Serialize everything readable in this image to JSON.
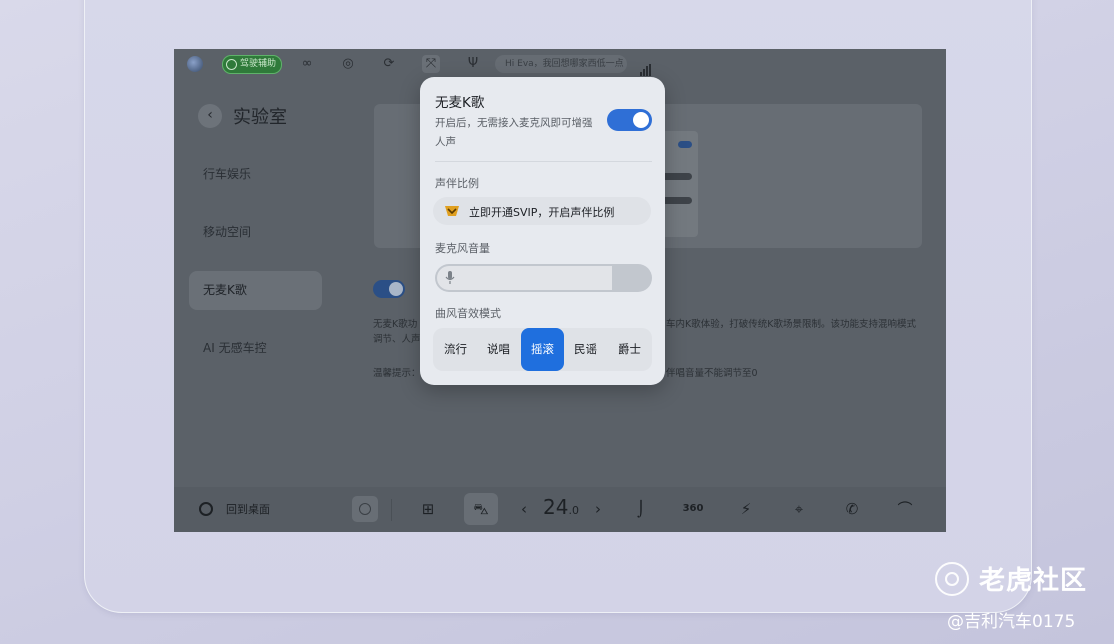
{
  "status_bar": {
    "assist_label": "驾驶辅助",
    "voice_hint": "Hi Eva，我回想哪家西低一点"
  },
  "nav": {
    "back_icon": "chevron-left-icon",
    "page_title": "实验室",
    "items": [
      {
        "label": "行车娱乐",
        "active": false
      },
      {
        "label": "移动空间",
        "active": false
      },
      {
        "label": "无麦K歌",
        "active": true
      },
      {
        "label": "AI 无感车控",
        "active": false
      }
    ]
  },
  "background_content": {
    "desc_left": "无麦K歌功调节、人声",
    "desc_right": "车内K歌体验，打破传统K歌场景限制。该功能支持混响模式",
    "tip_left": "温馨提示：",
    "tip_right": "伴唱音量不能调节至0"
  },
  "popup": {
    "title": "无麦K歌",
    "description": "开启后，无需接入麦克风即可增强人声",
    "toggle_on": true,
    "accompaniment_label": "声伴比例",
    "svip_text": "立即开通SVIP，开启声伴比例",
    "mic_volume_label": "麦克风音量",
    "mic_volume_fraction": 0.82,
    "mode_label": "曲风音效模式",
    "modes": [
      "流行",
      "说唱",
      "摇滚",
      "民谣",
      "爵士"
    ],
    "active_mode": "摇滚"
  },
  "dock": {
    "home_label": "回到桌面",
    "temperature_int": "24",
    "temperature_dec": ".0",
    "icons": [
      "media-icon",
      "apps-grid-icon",
      "car-icon",
      "chevron-left-icon",
      "chevron-right-icon",
      "seat-icon",
      "360-view-icon",
      "charge-icon",
      "location-icon",
      "phone-icon",
      "wiper-icon"
    ]
  },
  "watermark": {
    "title": "老虎社区",
    "subtitle": "@吉利汽车0175"
  },
  "colors": {
    "accent": "#1f6fde",
    "toggle_on": "#2f6fd6",
    "svip_gold": "#e0a020",
    "assist_green": "#2f7a3a"
  }
}
